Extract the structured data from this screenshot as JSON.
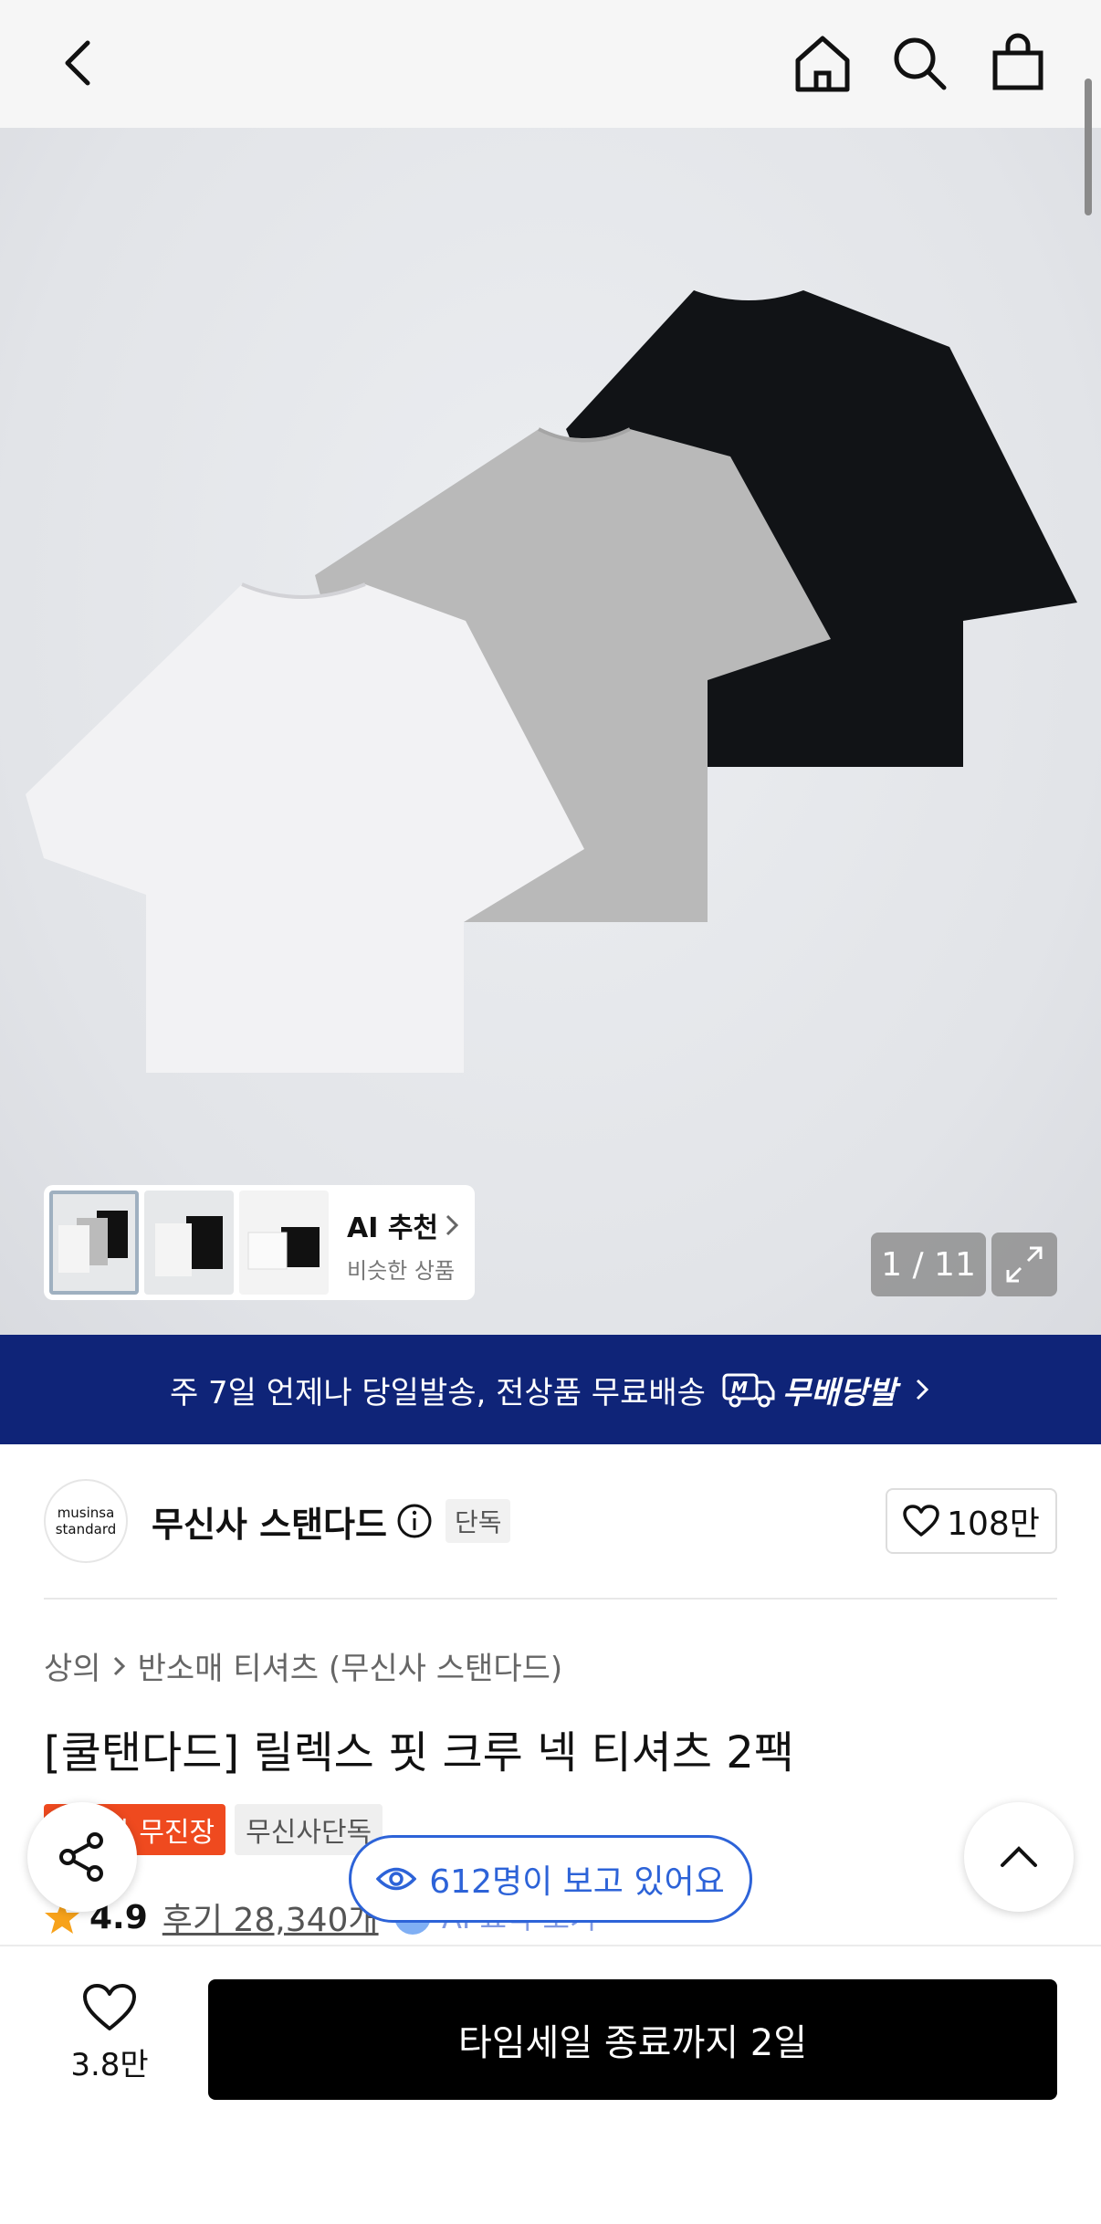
{
  "nav": {
    "back_icon": "chevron-left-icon",
    "home_icon": "home-icon",
    "search_icon": "search-icon",
    "cart_icon": "shopping-bag-icon"
  },
  "gallery": {
    "counter": "1 / 11",
    "ai_recommend_title": "AI 추천",
    "ai_recommend_sub": "비슷한 상품"
  },
  "banner": {
    "text": "주 7일 언제나 당일발송, 전상품 무료배송",
    "brand": "무배당발",
    "brand_badge": "M"
  },
  "brand": {
    "logo_line1": "musinsa",
    "logo_line2": "standard",
    "name": "무신사 스탠다드",
    "exclusive": "단독",
    "likes": "108만"
  },
  "breadcrumb": {
    "first": "상의",
    "second": "반소매 티셔츠 (무신사 스탠다드)"
  },
  "product": {
    "title": "[쿨탠다드] 릴렉스 핏 크루 넥 티셔츠 2팩",
    "badge_red": "무신사 무진장",
    "badge_gray": "무신사단독",
    "rating": "4.9",
    "reviews": "후기 28,340개",
    "ai_summary": "AI 요약 보기",
    "ai_summary_badge": "AI"
  },
  "viewers": {
    "text": "612명이 보고 있어요"
  },
  "bottom": {
    "wish_count": "3.8만",
    "buy_label": "타임세일 종료까지 2일"
  },
  "colors": {
    "banner_bg": "#0f2478",
    "badge_red": "#ef4a1f",
    "viewer_blue": "#2d63d8",
    "buy_bg": "#000000"
  }
}
